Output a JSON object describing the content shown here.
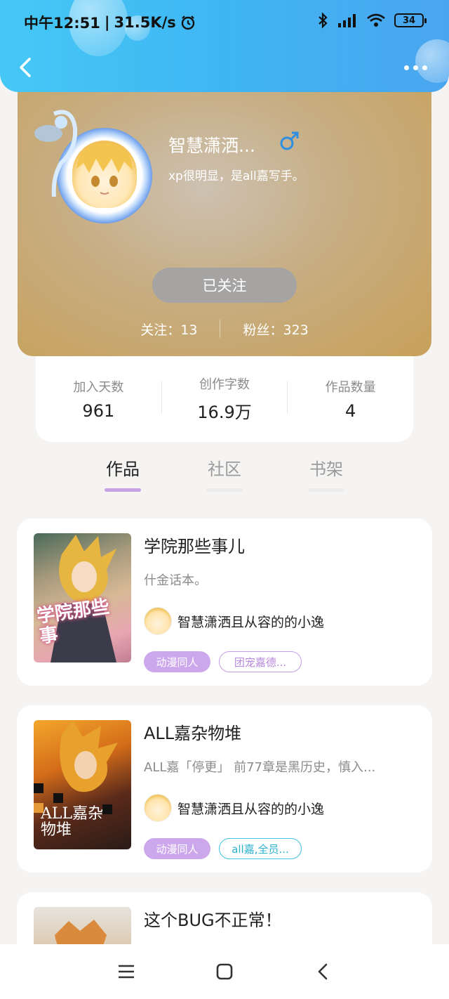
{
  "status": {
    "time": "中午12:51",
    "speed": "31.5K/s",
    "battery": "34"
  },
  "profile": {
    "username": "智慧潇洒...",
    "bio": "xp很明显，是all嘉写手。",
    "follow_button": "已关注",
    "following": "关注：13",
    "fans": "粉丝：323"
  },
  "stats": [
    {
      "label": "加入天数",
      "value": "961"
    },
    {
      "label": "创作字数",
      "value": "16.9万"
    },
    {
      "label": "作品数量",
      "value": "4"
    }
  ],
  "tabs": [
    {
      "label": "作品",
      "active": true
    },
    {
      "label": "社区",
      "active": false
    },
    {
      "label": "书架",
      "active": false
    }
  ],
  "books": [
    {
      "title": "学院那些事儿",
      "desc": "什金话本。",
      "author": "智慧潇洒且从容的的小逸",
      "tags": [
        "动漫同人",
        "团宠嘉德..."
      ],
      "cover_text": "学院那些事",
      "tag2_color": "#c79be6"
    },
    {
      "title": "ALL嘉杂物堆",
      "desc": "ALL嘉「停更」 前77章是黑历史，慎入...",
      "author": "智慧潇洒且从容的的小逸",
      "tags": [
        "动漫同人",
        "all嘉,全员..."
      ],
      "cover_text": "ALL嘉杂物堆",
      "tag2_color": "#3fc2dc"
    },
    {
      "title": "这个BUG不正常！"
    }
  ],
  "colors": {
    "header": "#46c8f6",
    "tab_active": "#c9a2e6",
    "tag_fill": "#cda7ec"
  }
}
